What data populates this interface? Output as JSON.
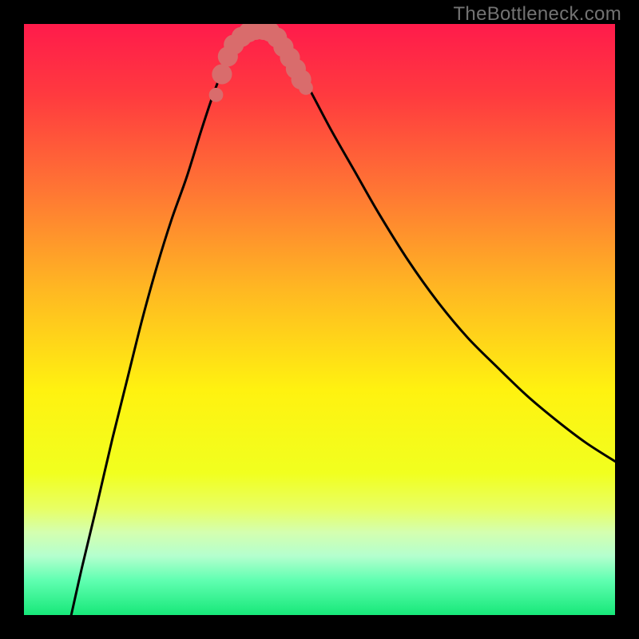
{
  "watermark": "TheBottleneck.com",
  "chart_data": {
    "type": "line",
    "title": "",
    "xlabel": "",
    "ylabel": "",
    "xlim": [
      0,
      100
    ],
    "ylim": [
      0,
      100
    ],
    "background_gradient": {
      "stops": [
        {
          "offset": 0,
          "color": "#ff1b4b"
        },
        {
          "offset": 12,
          "color": "#ff3a3f"
        },
        {
          "offset": 28,
          "color": "#ff7534"
        },
        {
          "offset": 45,
          "color": "#ffb822"
        },
        {
          "offset": 62,
          "color": "#fff210"
        },
        {
          "offset": 76,
          "color": "#f1ff1f"
        },
        {
          "offset": 82,
          "color": "#e8ff64"
        },
        {
          "offset": 86,
          "color": "#d4ffb0"
        },
        {
          "offset": 90,
          "color": "#b4ffce"
        },
        {
          "offset": 94,
          "color": "#62ffb2"
        },
        {
          "offset": 100,
          "color": "#17e879"
        }
      ]
    },
    "curve_left": [
      {
        "x": 8.0,
        "y": 0.0
      },
      {
        "x": 9.8,
        "y": 8.0
      },
      {
        "x": 12.2,
        "y": 18.0
      },
      {
        "x": 15.0,
        "y": 30.0
      },
      {
        "x": 17.5,
        "y": 40.0
      },
      {
        "x": 20.0,
        "y": 50.0
      },
      {
        "x": 22.5,
        "y": 59.0
      },
      {
        "x": 25.0,
        "y": 67.0
      },
      {
        "x": 27.5,
        "y": 74.0
      },
      {
        "x": 30.0,
        "y": 82.0
      },
      {
        "x": 32.0,
        "y": 88.0
      },
      {
        "x": 34.0,
        "y": 93.0
      },
      {
        "x": 36.0,
        "y": 96.0
      },
      {
        "x": 38.0,
        "y": 98.0
      },
      {
        "x": 39.5,
        "y": 99.0
      }
    ],
    "curve_right": [
      {
        "x": 41.0,
        "y": 99.0
      },
      {
        "x": 42.5,
        "y": 97.8
      },
      {
        "x": 45.0,
        "y": 94.5
      },
      {
        "x": 48.0,
        "y": 89.5
      },
      {
        "x": 52.0,
        "y": 82.0
      },
      {
        "x": 56.0,
        "y": 75.0
      },
      {
        "x": 60.0,
        "y": 68.0
      },
      {
        "x": 65.0,
        "y": 60.0
      },
      {
        "x": 70.0,
        "y": 53.0
      },
      {
        "x": 75.0,
        "y": 47.0
      },
      {
        "x": 80.0,
        "y": 42.0
      },
      {
        "x": 85.0,
        "y": 37.2
      },
      {
        "x": 90.0,
        "y": 33.0
      },
      {
        "x": 95.0,
        "y": 29.2
      },
      {
        "x": 100.0,
        "y": 26.0
      }
    ],
    "highlight": {
      "color": "#d96c6c",
      "points": [
        {
          "x": 32.5,
          "y": 88.0,
          "r": 1.2
        },
        {
          "x": 33.5,
          "y": 91.5,
          "r": 1.7
        },
        {
          "x": 34.5,
          "y": 94.5,
          "r": 1.7
        },
        {
          "x": 35.5,
          "y": 96.5,
          "r": 1.7
        },
        {
          "x": 36.8,
          "y": 97.8,
          "r": 1.7
        },
        {
          "x": 38.0,
          "y": 98.6,
          "r": 1.7
        },
        {
          "x": 39.2,
          "y": 99.0,
          "r": 1.7
        },
        {
          "x": 40.5,
          "y": 99.0,
          "r": 1.7
        },
        {
          "x": 41.6,
          "y": 98.7,
          "r": 1.7
        },
        {
          "x": 42.8,
          "y": 97.7,
          "r": 1.7
        },
        {
          "x": 43.9,
          "y": 96.1,
          "r": 1.7
        },
        {
          "x": 45.0,
          "y": 94.3,
          "r": 1.7
        },
        {
          "x": 46.0,
          "y": 92.4,
          "r": 1.7
        },
        {
          "x": 46.9,
          "y": 90.6,
          "r": 1.7
        },
        {
          "x": 47.7,
          "y": 89.2,
          "r": 1.2
        }
      ]
    }
  }
}
